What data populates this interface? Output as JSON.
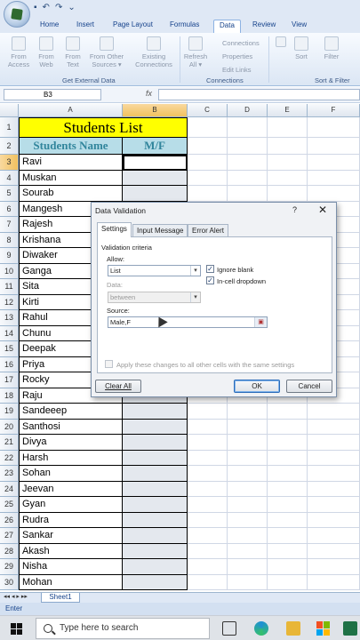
{
  "quick_access": {
    "save_glyph": "▪",
    "undo_glyph": "↶",
    "redo_glyph": "↷",
    "more_glyph": "⌄"
  },
  "tabs": [
    "Home",
    "Insert",
    "Page Layout",
    "Formulas",
    "Data",
    "Review",
    "View"
  ],
  "active_tab": "Data",
  "ribbon": {
    "get_external": [
      {
        "label": "From Access"
      },
      {
        "label": "From Web"
      },
      {
        "label": "From Text"
      },
      {
        "label": "From Other Sources ▾"
      },
      {
        "label": "Existing Connections"
      }
    ],
    "get_external_group": "Get External Data",
    "refresh": "Refresh All ▾",
    "connections_items": [
      "Connections",
      "Properties",
      "Edit Links"
    ],
    "connections_group": "Connections",
    "sort_label": "Sort",
    "filter_label": "Filter",
    "sort_group": "Sort & Filter"
  },
  "formula_bar": {
    "name_box": "B3",
    "fx": "fx",
    "value": ""
  },
  "columns": [
    "A",
    "B",
    "C",
    "D",
    "E",
    "F"
  ],
  "sheet": {
    "title": "Students  List",
    "header_name": "Students Name",
    "header_mf": "M/F",
    "rows": [
      {
        "n": "1"
      },
      {
        "n": "2"
      },
      {
        "n": "3",
        "name": "Ravi"
      },
      {
        "n": "4",
        "name": "Muskan"
      },
      {
        "n": "5",
        "name": "Sourab"
      },
      {
        "n": "6",
        "name": "Mangesh"
      },
      {
        "n": "7",
        "name": "Rajesh"
      },
      {
        "n": "8",
        "name": "Krishana"
      },
      {
        "n": "9",
        "name": "Diwaker"
      },
      {
        "n": "10",
        "name": "Ganga"
      },
      {
        "n": "11",
        "name": "Sita"
      },
      {
        "n": "12",
        "name": "Kirti"
      },
      {
        "n": "13",
        "name": "Rahul"
      },
      {
        "n": "14",
        "name": "Chunu"
      },
      {
        "n": "15",
        "name": "Deepak"
      },
      {
        "n": "16",
        "name": "Priya"
      },
      {
        "n": "17",
        "name": "Rocky"
      },
      {
        "n": "18",
        "name": "Raju"
      },
      {
        "n": "19",
        "name": "Sandeeep"
      },
      {
        "n": "20",
        "name": "Santhosi"
      },
      {
        "n": "21",
        "name": "Divya"
      },
      {
        "n": "22",
        "name": "Harsh"
      },
      {
        "n": "23",
        "name": "Sohan"
      },
      {
        "n": "24",
        "name": "Jeevan"
      },
      {
        "n": "25",
        "name": "Gyan"
      },
      {
        "n": "26",
        "name": "Rudra"
      },
      {
        "n": "27",
        "name": "Sankar"
      },
      {
        "n": "28",
        "name": "Akash"
      },
      {
        "n": "29",
        "name": "Nisha"
      },
      {
        "n": "30",
        "name": "Mohan"
      }
    ]
  },
  "dialog": {
    "title": "Data Validation",
    "help": "?",
    "close": "✕",
    "tabs": [
      "Settings",
      "Input Message",
      "Error Alert"
    ],
    "criteria_label": "Validation criteria",
    "allow_label": "Allow:",
    "allow_value": "List",
    "data_label": "Data:",
    "data_value": "between",
    "ignore_blank": "Ignore blank",
    "in_cell_dropdown": "In-cell dropdown",
    "source_label": "Source:",
    "source_value": "Male,F",
    "apply_all": "Apply these changes to all other cells with the same settings",
    "clear_all": "Clear All",
    "ok": "OK",
    "cancel": "Cancel"
  },
  "sheet_tabs": [
    "Sheet1"
  ],
  "status": "Enter",
  "taskbar": {
    "search_placeholder": "Type here to search"
  },
  "colors": {
    "title_fill": "#ffff00",
    "header_fill": "#b7dde8",
    "header_text": "#31859c",
    "selection": "#f1c15f"
  }
}
